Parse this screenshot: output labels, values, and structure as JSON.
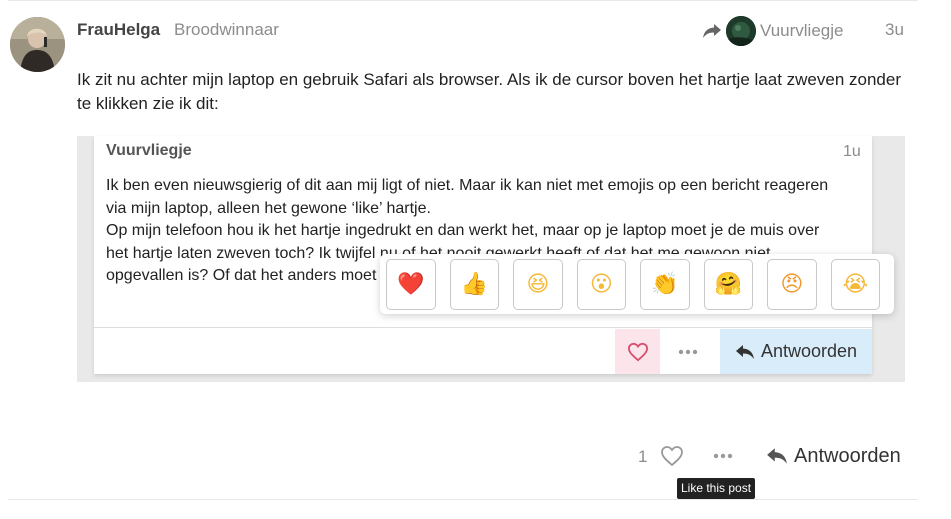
{
  "post": {
    "author_name": "FrauHelga",
    "author_title": "Broodwinnaar",
    "reply_to_name": "Vuurvliegje",
    "age": "3u",
    "body": "Ik zit nu achter mijn laptop en gebruik Safari als browser. Als ik de cursor boven het hartje laat zweven zonder te klikken zie ik dit:"
  },
  "quote": {
    "author_name": "Vuurvliegje",
    "age": "1u",
    "lines": [
      "Ik ben even nieuwsgierig of dit aan mij ligt of niet. Maar ik kan niet met emojis op een bericht reageren",
      "via mijn laptop, alleen het gewone ‘like’ hartje.",
      "Op mijn telefoon hou ik het hartje ingedrukt en dan werkt het, maar op je laptop moet je de muis over",
      "het hartje laten zweven toch? Ik twijfel nu of het nooit gewerkt heeft of dat het me gewoon niet",
      "opgevallen is? Of dat het anders moet"
    ],
    "reply_label": "Antwoorden"
  },
  "reactions": [
    {
      "name": "heart-reaction",
      "glyph": "❤️",
      "color": "#e0245e"
    },
    {
      "name": "thumbs-up-reaction",
      "glyph": "👍",
      "color": "#f5b93a"
    },
    {
      "name": "laughing-reaction",
      "glyph": "😆",
      "color": "#f5b93a"
    },
    {
      "name": "open-mouth-reaction",
      "glyph": "😮",
      "color": "#f5b93a"
    },
    {
      "name": "clapping-reaction",
      "glyph": "👏",
      "color": "#f5b93a"
    },
    {
      "name": "hugging-reaction",
      "glyph": "🤗",
      "color": "#f5b93a"
    },
    {
      "name": "angry-reaction",
      "glyph": "😠",
      "color": "#f29a2e"
    },
    {
      "name": "crying-reaction",
      "glyph": "😭",
      "color": "#f5b93a"
    }
  ],
  "actions": {
    "like_count": "1",
    "reply_label": "Antwoorden",
    "like_tooltip": "Like this post"
  },
  "icons": {
    "share_arrow": "share-arrow-icon",
    "heart": "heart-icon",
    "more": "more-icon",
    "reply": "reply-icon"
  },
  "colors": {
    "liked_heart": "#d6506f",
    "muted": "#8c8c8c",
    "reply_highlight": "#d8ecfa",
    "like_highlight": "#fbe4ea"
  }
}
